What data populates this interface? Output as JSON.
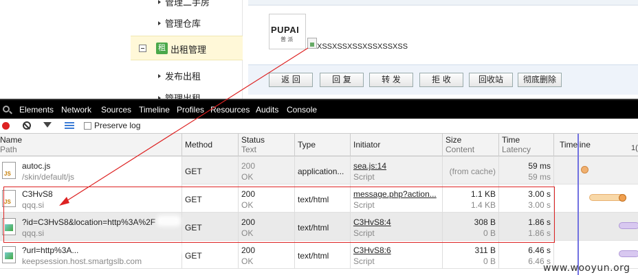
{
  "left_menu": {
    "item_top": "管理二手房",
    "item_warehouse": "管理仓库",
    "active_section": "出租管理",
    "active_badge": "租",
    "item_publish": "发布出租",
    "item_manage": "管理出租"
  },
  "message": {
    "logo_text": "PUPAI",
    "logo_sub": "普 派",
    "subject": "XSSXSSXSSXSSXSSXSS"
  },
  "buttons": {
    "back": "返 回",
    "reply": "回 复",
    "forward": "转 发",
    "reject": "拒 收",
    "recycle": "回收站",
    "delete": "彻底删除"
  },
  "devtools": {
    "tabs": [
      "Elements",
      "Network",
      "Sources",
      "Timeline",
      "Profiles",
      "Resources",
      "Audits",
      "Console"
    ],
    "preserve_log": "Preserve log",
    "columns": {
      "name": "Name",
      "path": "Path",
      "method": "Method",
      "status": "Status",
      "text": "Text",
      "type": "Type",
      "initiator": "Initiator",
      "size": "Size",
      "content": "Content",
      "time": "Time",
      "latency": "Latency",
      "timeline": "Timeline",
      "timeline_tick": "1("
    },
    "rows": [
      {
        "name": "autoc.js",
        "path": "/skin/default/js",
        "method": "GET",
        "status": "200",
        "status_text": "OK",
        "type": "application...",
        "initiator": "sea.js:14",
        "initiator_type": "Script",
        "size": "(from cache)",
        "content": "",
        "time": "59 ms",
        "latency": "59 ms"
      },
      {
        "name": "C3HvS8",
        "path": "qqq.si",
        "method": "GET",
        "status": "200",
        "status_text": "OK",
        "type": "text/html",
        "initiator": "message.php?action...",
        "initiator_type": "Script",
        "size": "1.1 KB",
        "content": "1.4 KB",
        "time": "3.00 s",
        "latency": "3.00 s"
      },
      {
        "name": "?id=C3HvS8&location=http%3A%2F",
        "path": "qqq.si",
        "method": "GET",
        "status": "200",
        "status_text": "OK",
        "type": "text/html",
        "initiator": "C3HvS8:4",
        "initiator_type": "Script",
        "size": "308 B",
        "content": "0 B",
        "time": "1.86 s",
        "latency": "1.86 s"
      },
      {
        "name": "?url=http%3A...",
        "path": "keepsession.host.smartgslb.com",
        "method": "GET",
        "status": "200",
        "status_text": "OK",
        "type": "text/html",
        "initiator": "C3HvS8:6",
        "initiator_type": "Script",
        "size": "311 B",
        "content": "0 B",
        "time": "6.46 s",
        "latency": "6.46 s"
      }
    ]
  },
  "watermark": "www.wooyun.org",
  "colors": {
    "accent_red": "#dd2222",
    "timeline_blue": "#7070e0",
    "bar_orange": "#f5c27a",
    "bar_purple": "#c8b0e8"
  }
}
